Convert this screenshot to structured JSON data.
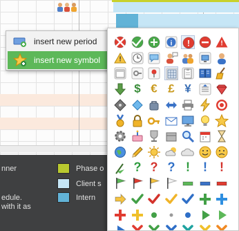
{
  "menu": {
    "items": [
      {
        "label": "insert new period",
        "icon": "period-icon",
        "active": false
      },
      {
        "label": "insert new symbol",
        "icon": "star-icon",
        "active": true
      }
    ]
  },
  "legend": {
    "left_fragments": [
      "nner",
      "edule.",
      "with it as"
    ],
    "items": [
      {
        "label": "Phase o",
        "color": "#b9c92f"
      },
      {
        "label": "Client s",
        "color": "#c6e6f6"
      },
      {
        "label": "Intern",
        "color": "#62b3d7"
      }
    ]
  },
  "schedule": {
    "group_icon": "people-icon",
    "bar_colors": {
      "phase": "#c8d12b",
      "client": "#c6e6f6",
      "intern": "#62b3d7"
    },
    "highlight_rows": "#fbe9dd"
  },
  "palette": {
    "symbols": [
      "no-entry-icon",
      "check-circle-icon",
      "plus-circle-icon",
      "info-circle-icon",
      "alert-circle-icon",
      "minus-circle-icon",
      "warning-icon",
      "warning-small-icon",
      "clock-icon",
      "chat-icon",
      "user-chat-icon",
      "group-icon",
      "computer-user-icon",
      "user-icon",
      "calendar-icon",
      "key-icon",
      "pin-icon",
      "grid-icon",
      "clipboard-icon",
      "book-icon",
      "broom-icon",
      "arrow-down-icon",
      "dollar-icon",
      "euro-icon",
      "pound-icon",
      "yen-icon",
      "list-up-icon",
      "gem-icon",
      "tag-diamond-icon",
      "diamond-icon",
      "bag-icon",
      "arrows-icon",
      "printer-icon",
      "lightning-icon",
      "target-icon",
      "medal-icon",
      "padlock-icon",
      "key-gold-icon",
      "envelope-icon",
      "monitor-icon",
      "bulb-icon",
      "star-icon",
      "gear-icon",
      "cake-icon",
      "trophy-icon",
      "box-icon",
      "magnifier-icon",
      "calendar-red-icon",
      "hourglass-icon",
      "globe-icon",
      "pencil-icon",
      "sun-icon",
      "cloud-sun-icon",
      "cloud-icon",
      "smiley-icon",
      "sad-icon",
      "flag-green-icon",
      "question-green-icon",
      "question-red-icon",
      "question-blue-icon",
      "exclaim-green-icon",
      "exclaim-blue-icon",
      "exclaim-red-icon",
      "flag-green2-icon",
      "flag-red-icon",
      "flag-yellow-icon",
      "flag-white-icon",
      "bar-green-icon",
      "bar-blue-icon",
      "bar-red-icon",
      "arrow-right-yellow-icon",
      "check-green-icon",
      "check-red-icon",
      "check-yellow-icon",
      "check-blue-icon",
      "plus-green-icon",
      "plus-blue-icon",
      "plus-red-icon",
      "plus-yellow-icon",
      "dot-green-icon",
      "dot-small-icon",
      "dot-blue-icon",
      "arrow-right-green-icon",
      "arrow-right-green2-icon",
      "arrow-right-blue-icon",
      "x-red-icon",
      "x-green-icon",
      "x-blue-icon",
      "x-teal-icon",
      "x-yellow-icon",
      "x-orange-icon"
    ]
  }
}
